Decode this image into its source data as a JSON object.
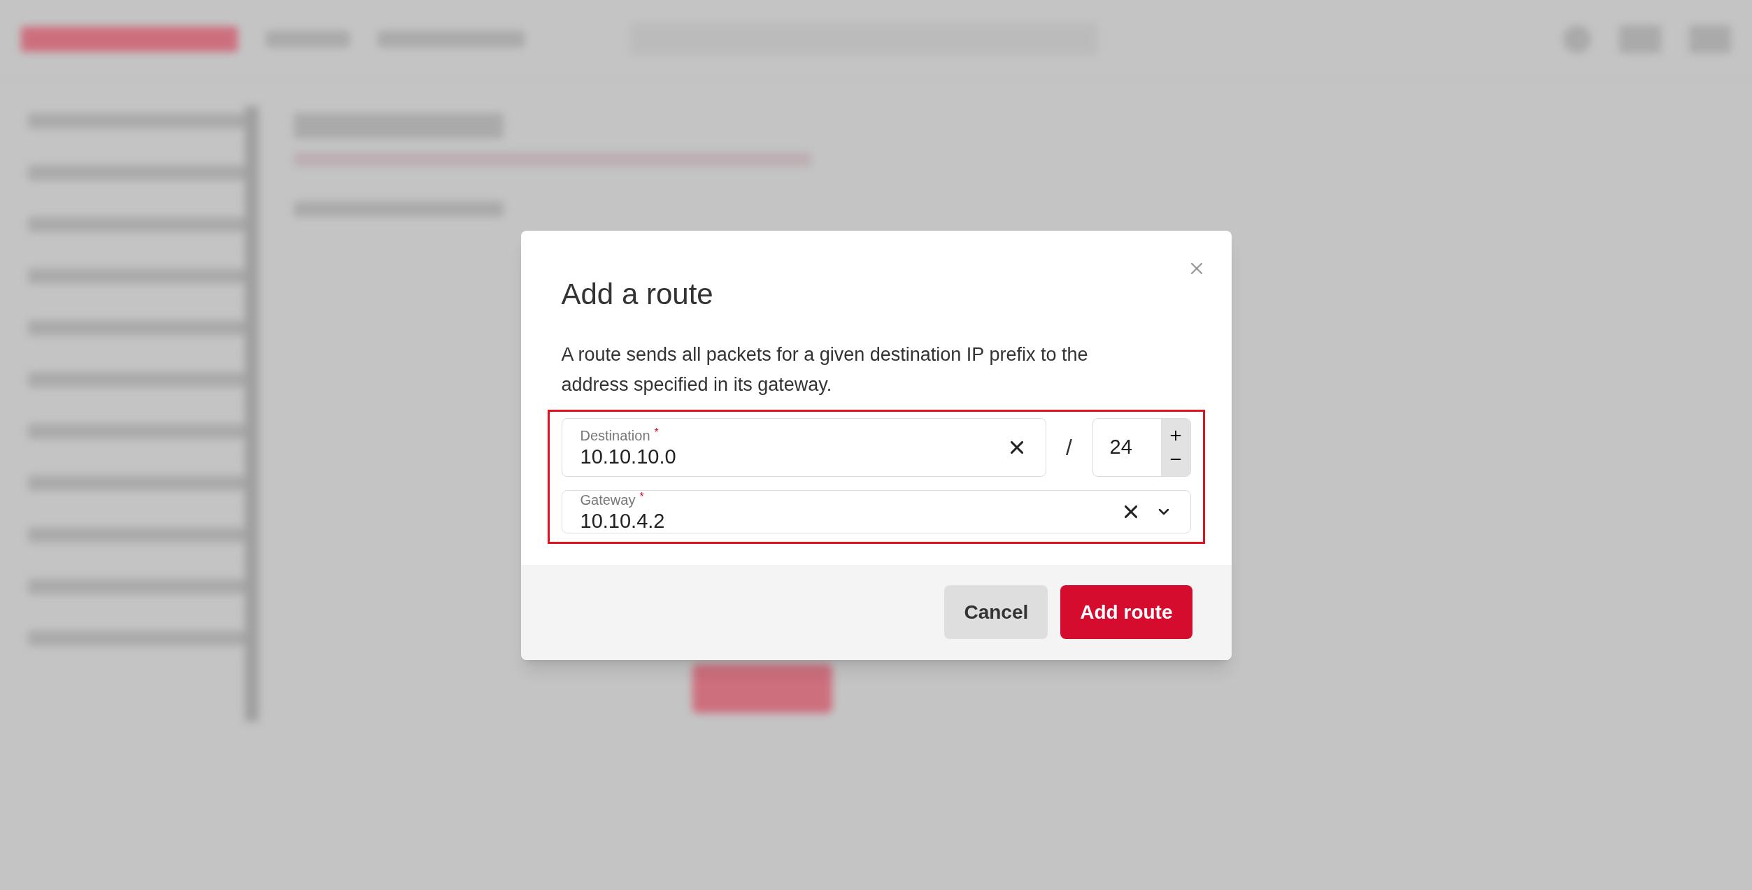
{
  "dialog": {
    "title": "Add a route",
    "description": "A route sends all packets for a given destination IP prefix to the address specified in its gateway.",
    "destination": {
      "label": "Destination",
      "required_mark": "*",
      "value": "10.10.10.0"
    },
    "separator": "/",
    "prefix": {
      "value": "24"
    },
    "gateway": {
      "label": "Gateway",
      "required_mark": "*",
      "value": "10.10.4.2"
    },
    "buttons": [
      {
        "label": "Cancel",
        "kind": "secondary"
      },
      {
        "label": "Add route",
        "kind": "primary"
      }
    ]
  }
}
